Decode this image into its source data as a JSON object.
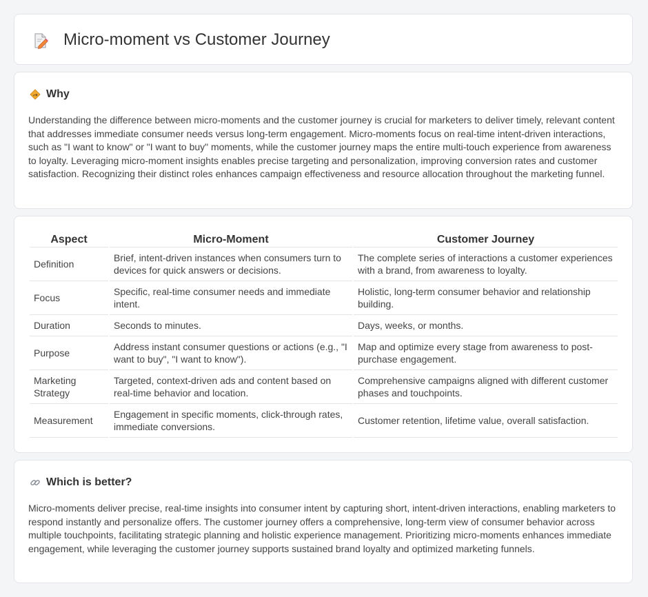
{
  "header": {
    "title": "Micro-moment vs Customer Journey",
    "icon": "document-pencil-icon"
  },
  "why": {
    "icon": "diamond-signpost-icon",
    "title": "Why",
    "text": "Understanding the difference between micro-moments and the customer journey is crucial for marketers to deliver timely, relevant content that addresses immediate consumer needs versus long-term engagement. Micro-moments focus on real-time intent-driven interactions, such as \"I want to know\" or \"I want to buy\" moments, while the customer journey maps the entire multi-touch experience from awareness to loyalty. Leveraging micro-moment insights enables precise targeting and personalization, improving conversion rates and customer satisfaction. Recognizing their distinct roles enhances campaign effectiveness and resource allocation throughout the marketing funnel."
  },
  "table": {
    "headers": [
      "Aspect",
      "Micro-Moment",
      "Customer Journey"
    ],
    "rows": [
      [
        "Definition",
        "Brief, intent-driven instances when consumers turn to devices for quick answers or decisions.",
        "The complete series of interactions a customer experiences with a brand, from awareness to loyalty."
      ],
      [
        "Focus",
        "Specific, real-time consumer needs and immediate intent.",
        "Holistic, long-term consumer behavior and relationship building."
      ],
      [
        "Duration",
        "Seconds to minutes.",
        "Days, weeks, or months."
      ],
      [
        "Purpose",
        "Address instant consumer questions or actions (e.g., \"I want to buy\", \"I want to know\").",
        "Map and optimize every stage from awareness to post-purchase engagement."
      ],
      [
        "Marketing Strategy",
        "Targeted, context-driven ads and content based on real-time behavior and location.",
        "Comprehensive campaigns aligned with different customer phases and touchpoints."
      ],
      [
        "Measurement",
        "Engagement in specific moments, click-through rates, immediate conversions.",
        "Customer retention, lifetime value, overall satisfaction."
      ]
    ]
  },
  "better": {
    "icon": "link-icon",
    "title": "Which is better?",
    "text": "Micro-moments deliver precise, real-time insights into consumer intent by capturing short, intent-driven interactions, enabling marketers to respond instantly and personalize offers. The customer journey offers a comprehensive, long-term view of consumer behavior across multiple touchpoints, facilitating strategic planning and holistic experience management. Prioritizing micro-moments enhances immediate engagement, while leveraging the customer journey supports sustained brand loyalty and optimized marketing funnels."
  },
  "colors": {
    "background": "#f4f5f7",
    "card": "#ffffff",
    "border": "#e3e5e8",
    "text": "#333333",
    "icon_accent": "#e8a33c"
  }
}
